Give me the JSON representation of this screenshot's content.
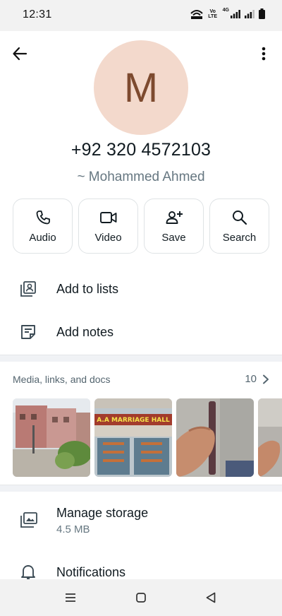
{
  "status_bar": {
    "time": "12:31",
    "volte_top": "Vo",
    "volte_bottom": "LTE",
    "net_type": "4G"
  },
  "contact": {
    "avatar_letter": "M",
    "phone": "+92 320 4572103",
    "name": "~ Mohammed Ahmed"
  },
  "actions": [
    {
      "label": "Audio",
      "icon": "phone-icon"
    },
    {
      "label": "Video",
      "icon": "video-icon"
    },
    {
      "label": "Save",
      "icon": "add-person-icon"
    },
    {
      "label": "Search",
      "icon": "search-icon"
    }
  ],
  "options": {
    "add_to_lists": "Add to lists",
    "add_notes": "Add notes"
  },
  "media": {
    "title": "Media, links, and docs",
    "count": "10",
    "thumb_sign_text": "A.A MARRIAGE HALL"
  },
  "storage": {
    "title": "Manage storage",
    "size": "4.5 MB"
  },
  "notifications": {
    "title": "Notifications"
  },
  "colors": {
    "avatar_bg": "#f3d9cc",
    "avatar_fg": "#7d4a2f",
    "secondary_text": "#667781"
  }
}
